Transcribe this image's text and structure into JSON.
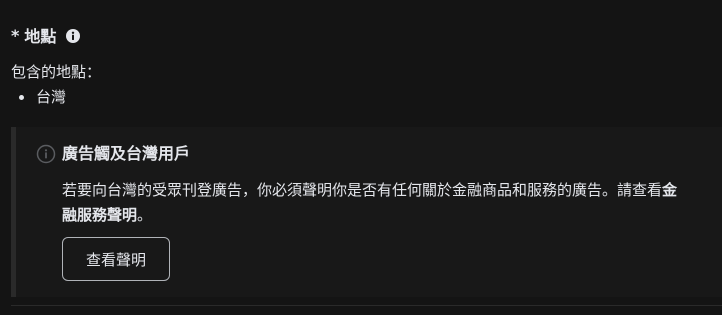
{
  "location_section": {
    "required_marker": "*",
    "heading": "地點",
    "icon": "info-icon",
    "included_label": "包含的地點：",
    "locations": [
      "台灣"
    ]
  },
  "notice": {
    "icon": "info-outline-icon",
    "title": "廣告觸及台灣用戶",
    "body_prefix": "若要向台灣的受眾刊登廣告，你必須聲明你是否有任何關於金融商品和服務的廣告。請查看",
    "body_link": "金融服務聲明",
    "body_suffix": "。",
    "button_label": "查看聲明"
  },
  "colors": {
    "background": "#141414",
    "panel": "#181818",
    "text": "#e4e6eb",
    "border": "#b0b3b8"
  }
}
